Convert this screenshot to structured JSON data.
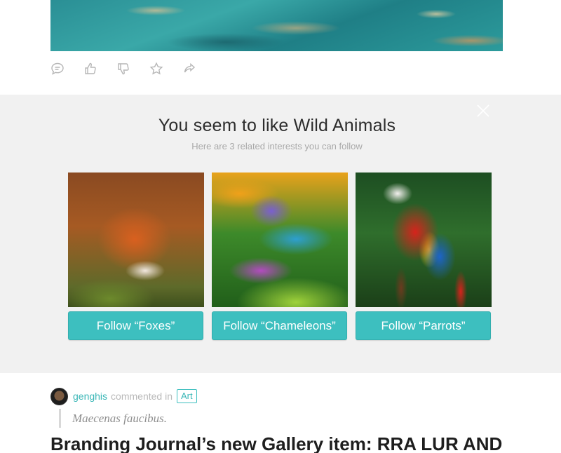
{
  "feed": {
    "actions": [
      {
        "name": "comment-icon"
      },
      {
        "name": "thumbs-up-icon"
      },
      {
        "name": "thumbs-down-icon"
      },
      {
        "name": "star-icon"
      },
      {
        "name": "share-icon"
      }
    ]
  },
  "suggestion": {
    "title": "You seem to like Wild Animals",
    "subtitle": "Here are 3 related interests you can follow",
    "close_icon": "close-icon",
    "cards": [
      {
        "image": "fox-photo",
        "button_label": "Follow “Foxes”"
      },
      {
        "image": "chameleon-photo",
        "button_label": "Follow “Chameleons”"
      },
      {
        "image": "parrot-photo",
        "button_label": "Follow “Parrots”"
      }
    ]
  },
  "activity": {
    "username": "genghis",
    "action_text": "commented in",
    "tag": "Art",
    "quote": "Maecenas faucibus.",
    "post_title": "Branding Journal’s new Gallery item: RRA LUR AND"
  },
  "colors": {
    "accent": "#3dbfbf",
    "panel_bg": "#f1f1f1",
    "icon_gray": "#b6b6b6"
  }
}
